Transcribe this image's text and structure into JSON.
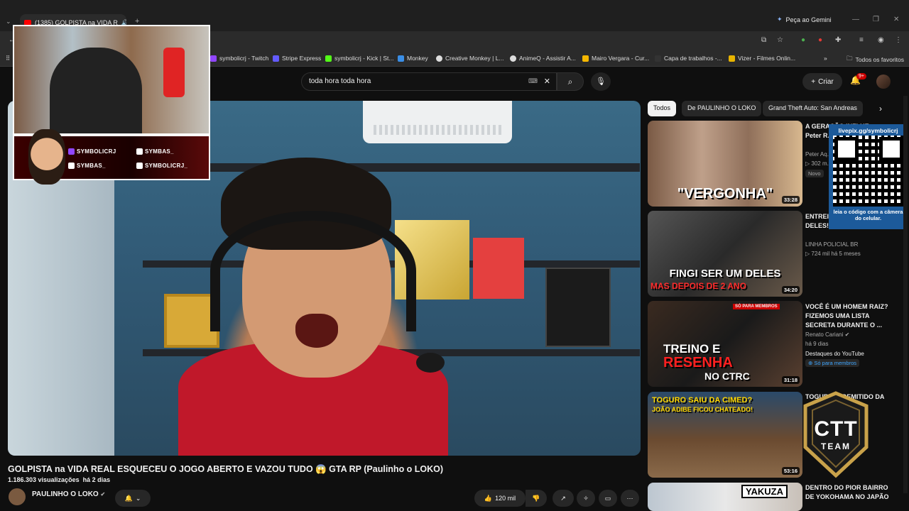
{
  "browser": {
    "tab_title": "(1385) GOLPISTA na VIDA R",
    "gemini_label": "Peça ao Gemini",
    "bookmarks": [
      "symbolicrj - Twitch",
      "Stripe Express",
      "symbolicrj - Kick | St...",
      "Monkey",
      "Creative Monkey | L...",
      "AnimeQ - Assistir A...",
      "Mairo Vergara - Cur...",
      "Capa de trabalhos -...",
      "Vizer - Filmes Onlin..."
    ],
    "all_bookmarks": "Todos os favoritos"
  },
  "youtube": {
    "search_value": "toda hora toda hora",
    "create_label": "Criar",
    "notif_count": "9+",
    "chips": [
      "Todos",
      "De PAULINHO O LOKO",
      "Grand Theft Auto: San Andreas"
    ]
  },
  "overlay": {
    "socials": [
      "SYMBOLICRJ",
      "SYMBAS_",
      "SYMBAS_",
      "SYMBOLICRJ_"
    ],
    "qr_header": "livepix.gg/symbolicrj",
    "qr_footer": "leia o código com a câmera do celular.",
    "ctt_line1": "CTT",
    "ctt_line2": "TEAM"
  },
  "video": {
    "title": "GOLPISTA na VIDA REAL ESQUECEU O JOGO ABERTO E VAZOU TUDO 😱 GTA RP (Paulinho o LOKO)",
    "views": "1.186.303 visualizações",
    "date": "há 2 dias",
    "channel": "PAULINHO O LOKO",
    "likes": "120 mil"
  },
  "recommendations": [
    {
      "thumb_text": "\"VERGONHA\"",
      "duration": "33:28",
      "title": "A GERAÇÃO INFLUE... Peter R...",
      "channel": "Peter Aq...",
      "meta": "302 m...",
      "badge": "Novo"
    },
    {
      "thumb_text": "FINGI SER UM DELES",
      "thumb_text2": "MAS DEPOIS DE 2 ANO",
      "duration": "34:20",
      "title": "ENTREI ... POR 2 A... UM DELES! |CORONEL ...",
      "channel": "LINHA POLICIAL BR",
      "meta": "724 mil  há 5 meses"
    },
    {
      "thumb_text": "TREINO E",
      "thumb_text2": "RESENHA",
      "thumb_text3": "NO CTRC",
      "tag": "SÓ PARA MEMBROS",
      "duration": "31:18",
      "title": "VOCÊ É UM HOMEM RAIZ? FIZEMOS UMA LISTA SECRETA DURANTE O ...",
      "channel": "Renato Cariani",
      "meta": "há 9 dias",
      "extra": "Destaques do YouTube",
      "members": "Só para membros"
    },
    {
      "thumb_text": "TOGURO SAIU DA CIMED?",
      "thumb_text2": "JOÃO ADIBE FICOU CHATEADO!",
      "duration": "53:16",
      "title": "TOGURO ... DEMITIDO DA ... O JOGO"
    },
    {
      "thumb_text": "YAKUZA",
      "title": "DENTRO DO PIOR BAIRRO DE YOKOHAMA NO JAPÃO"
    }
  ]
}
